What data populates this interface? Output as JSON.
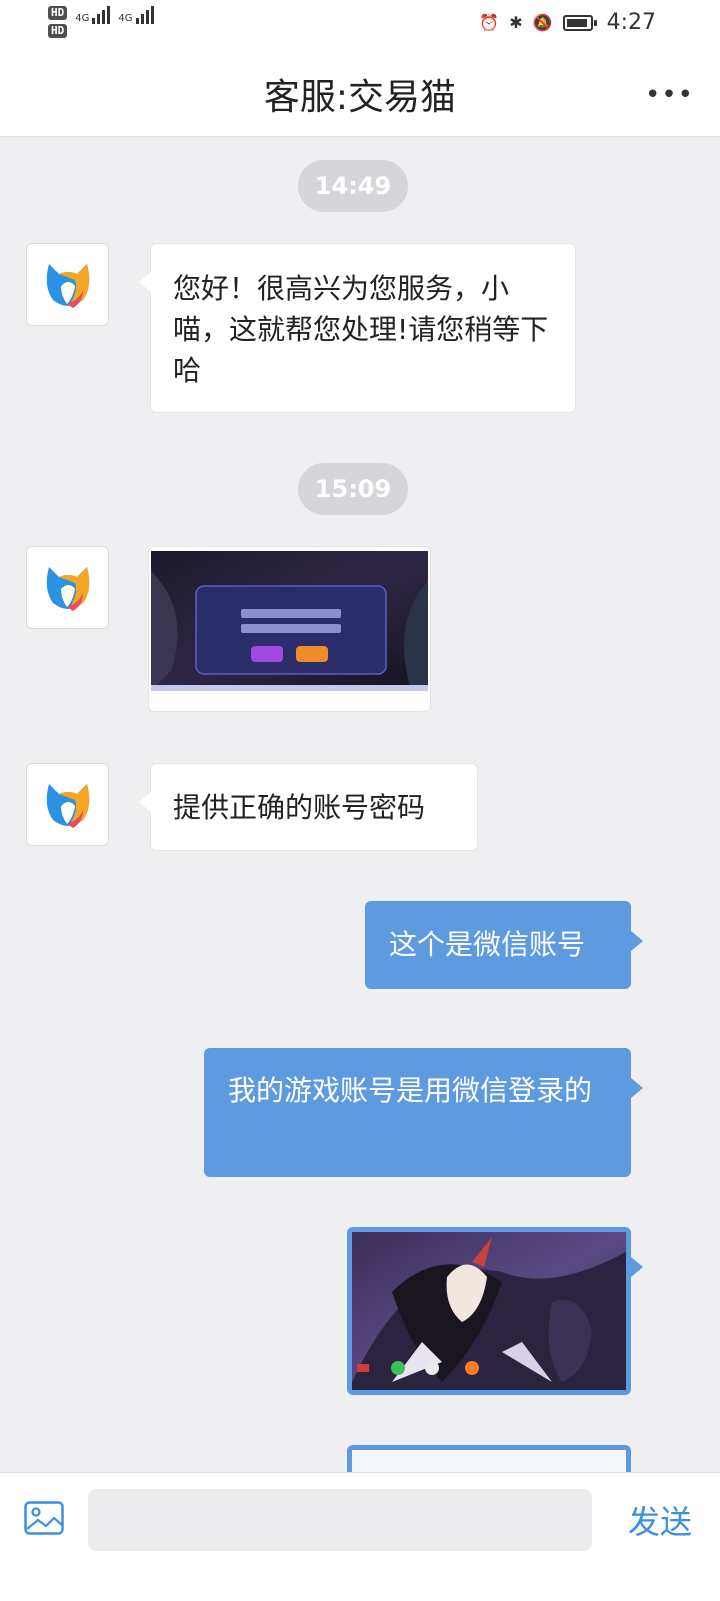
{
  "status_bar": {
    "hd1": "HD",
    "hd2": "HD",
    "net1": "4G",
    "net2": "4G",
    "time": "4:27",
    "icons": [
      "alarm-icon",
      "bluetooth-icon",
      "mute-icon",
      "battery-icon"
    ]
  },
  "header": {
    "title": "客服:交易猫",
    "more": "•••"
  },
  "messages": {
    "ts1": "14:49",
    "m1_text": "您好！很高兴为您服务，小喵，这就帮您处理!请您稍等下哈",
    "ts2": "15:09",
    "m3_text": "提供正确的账号密码",
    "m4_text": "这个是微信账号",
    "m5_text": "我的游戏账号是用微信登录的"
  },
  "input_bar": {
    "placeholder": "",
    "send_label": "发送"
  },
  "colors": {
    "accent": "#5e9ae0",
    "send": "#3d8fe0",
    "background": "#efeff1"
  }
}
